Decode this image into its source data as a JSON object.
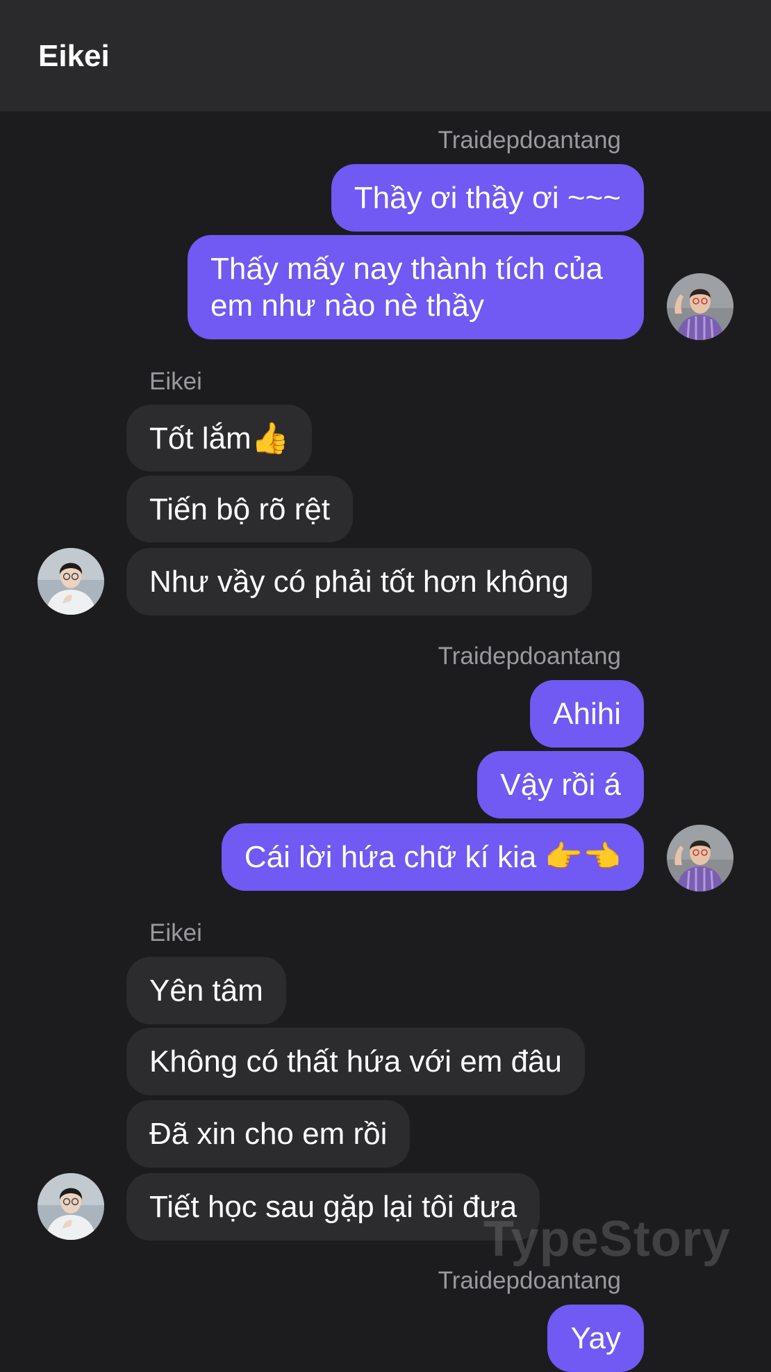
{
  "header": {
    "title": "Eikei"
  },
  "watermark": "TypeStory",
  "groups": [
    {
      "sender": "Traidepdoantang",
      "messages": [
        "Thầy ơi thầy ơi ~~~",
        "Thấy mấy nay thành tích của",
        "em như nào nè thầy"
      ]
    },
    {
      "sender": "Eikei",
      "messages": [
        "Tốt lắm👍",
        "Tiến bộ rõ rệt",
        "Như vầy có phải tốt hơn không"
      ]
    },
    {
      "sender": "Traidepdoantang",
      "messages": [
        "Ahihi",
        "Vậy rồi á",
        "Cái lời hứa chữ kí kia 👉👈"
      ]
    },
    {
      "sender": "Eikei",
      "messages": [
        "Yên tâm",
        "Không có thất hứa với em đâu",
        "Đã xin cho em rồi",
        "Tiết học sau gặp lại tôi đưa"
      ]
    },
    {
      "sender": "Traidepdoantang",
      "messages": [
        "Yay"
      ]
    }
  ],
  "avatars": {
    "outgoing": "avatar-purple-shirt",
    "incoming": "avatar-white-shirt"
  },
  "colors": {
    "outgoing_bubble": "#7159f3",
    "incoming_bubble": "#2c2c2e",
    "background": "#1c1c1e",
    "header": "#2a2a2c"
  }
}
